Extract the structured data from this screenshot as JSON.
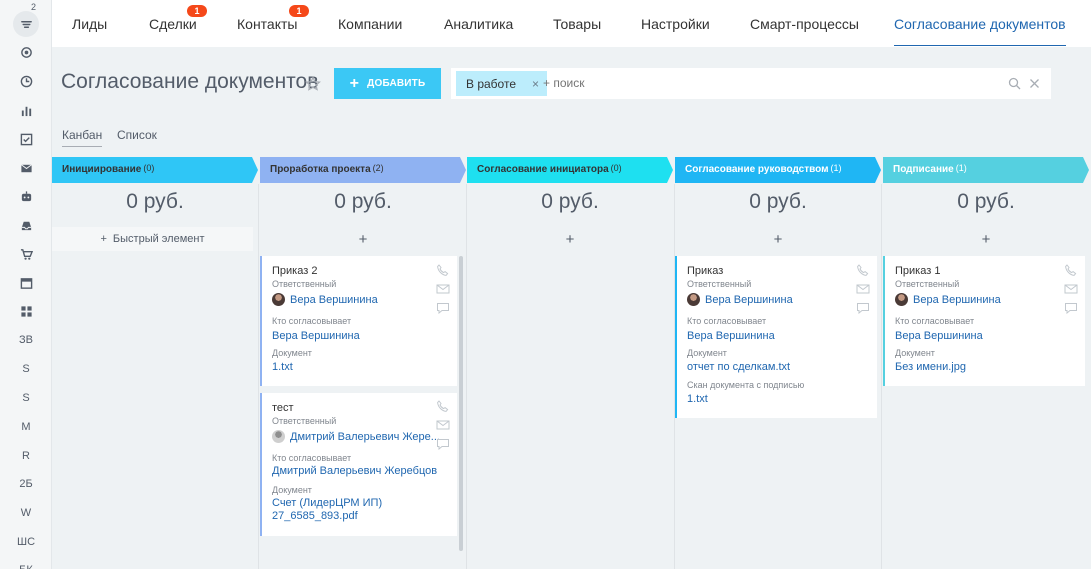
{
  "rail": {
    "counter": "2",
    "items": [
      "ЗВ",
      "S",
      "S",
      "M",
      "R",
      "2Б",
      "W",
      "ШС",
      "БК"
    ]
  },
  "nav": {
    "items": [
      {
        "label": "Лиды"
      },
      {
        "label": "Сделки",
        "badge": "1"
      },
      {
        "label": "Контакты",
        "badge": "1"
      },
      {
        "label": "Компании"
      },
      {
        "label": "Аналитика"
      },
      {
        "label": "Товары"
      },
      {
        "label": "Настройки"
      },
      {
        "label": "Смарт-процессы"
      },
      {
        "label": "Согласование документов",
        "active": true
      }
    ]
  },
  "header": {
    "title": "Согласование документов",
    "add_label": "ДОБАВИТЬ",
    "filter_chip": "В работе",
    "search_placeholder": "+ поиск"
  },
  "view_tabs": [
    "Канбан",
    "Список"
  ],
  "colors": {
    "accent": "#3bc8f5",
    "link": "#2067b0",
    "stage1": "#2fc6f6",
    "stage2": "#8fb2f2",
    "stage3": "#1ee0f0",
    "stage4": "#1fb6f4",
    "stage5": "#55d0e0"
  },
  "columns": [
    {
      "title": "Инициирование",
      "count": "(0)",
      "sum": "0 руб.",
      "quick": "Быстрый элемент"
    },
    {
      "title": "Проработка проекта",
      "count": "(2)",
      "sum": "0 руб.",
      "plus": "+"
    },
    {
      "title": "Согласование инициатора",
      "count": "(0)",
      "sum": "0 руб.",
      "plus": "+"
    },
    {
      "title": "Согласование руководством",
      "count": "(1)",
      "sum": "0 руб.",
      "plus": "+"
    },
    {
      "title": "Подписание",
      "count": "(1)",
      "sum": "0 руб.",
      "plus": "+"
    }
  ],
  "cards": [
    {
      "title": "Приказ 2",
      "responsible_label": "Ответственный",
      "responsible": "Вера Вершинина",
      "approver_label": "Кто согласовывает",
      "approver": "Вера Вершинина",
      "doc_label": "Документ",
      "doc": "1.txt"
    },
    {
      "title": "тест",
      "responsible_label": "Ответственный",
      "responsible": "Дмитрий Валерьевич Жере...",
      "approver_label": "Кто согласовывает",
      "approver": "Дмитрий Валерьевич Жеребцов",
      "doc_label": "Документ",
      "doc_line1": "Счет (ЛидерЦРМ ИП)",
      "doc_line2": "27_6585_893.pdf"
    },
    {
      "title": "Приказ",
      "responsible_label": "Ответственный",
      "responsible": "Вера Вершинина",
      "approver_label": "Кто согласовывает",
      "approver": "Вера Вершинина",
      "doc_label": "Документ",
      "doc": "отчет по сделкам.txt",
      "scan_label": "Скан документа с подписью",
      "scan": "1.txt"
    },
    {
      "title": "Приказ 1",
      "responsible_label": "Ответственный",
      "responsible": "Вера Вершинина",
      "approver_label": "Кто согласовывает",
      "approver": "Вера Вершинина",
      "doc_label": "Документ",
      "doc": "Без имени.jpg"
    }
  ]
}
